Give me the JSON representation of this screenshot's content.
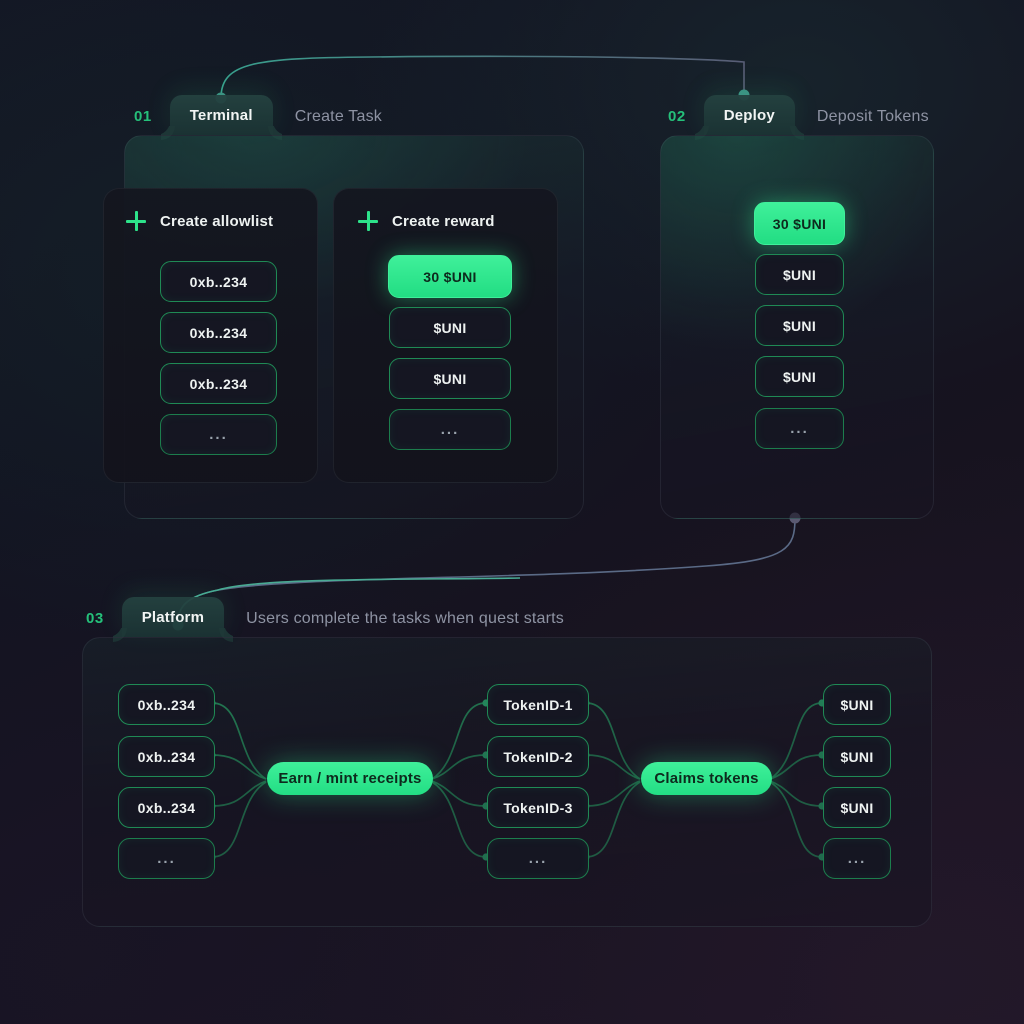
{
  "theme": {
    "accent": "#2EE48A",
    "accent_dark": "#1F8A55",
    "step_number_color": "#25C07A",
    "background": "#15131F",
    "muted_text": "#8E93A3"
  },
  "steps": [
    {
      "number": "01",
      "tab_label": "Terminal",
      "description": "Create Task",
      "panels": [
        {
          "icon": "plus-icon",
          "title": "Create allowlist",
          "items": [
            {
              "label": "0xb..234",
              "highlighted": false
            },
            {
              "label": "0xb..234",
              "highlighted": false
            },
            {
              "label": "0xb..234",
              "highlighted": false
            },
            {
              "label": "...",
              "highlighted": false,
              "is_dots": true
            }
          ]
        },
        {
          "icon": "plus-icon",
          "title": "Create reward",
          "items": [
            {
              "label": "30 $UNI",
              "highlighted": true
            },
            {
              "label": "$UNI",
              "highlighted": false
            },
            {
              "label": "$UNI",
              "highlighted": false
            },
            {
              "label": "...",
              "highlighted": false,
              "is_dots": true
            }
          ]
        }
      ]
    },
    {
      "number": "02",
      "tab_label": "Deploy",
      "description": "Deposit Tokens",
      "items": [
        {
          "label": "30 $UNI",
          "highlighted": true
        },
        {
          "label": "$UNI",
          "highlighted": false
        },
        {
          "label": "$UNI",
          "highlighted": false
        },
        {
          "label": "$UNI",
          "highlighted": false
        },
        {
          "label": "...",
          "highlighted": false,
          "is_dots": true
        }
      ]
    },
    {
      "number": "03",
      "tab_label": "Platform",
      "description": "Users complete the tasks when quest starts",
      "columns": [
        {
          "name": "wallets",
          "items": [
            {
              "label": "0xb..234"
            },
            {
              "label": "0xb..234"
            },
            {
              "label": "0xb..234"
            },
            {
              "label": "...",
              "is_dots": true
            }
          ]
        },
        {
          "name": "token-ids",
          "items": [
            {
              "label": "TokenID-1"
            },
            {
              "label": "TokenID-2"
            },
            {
              "label": "TokenID-3"
            },
            {
              "label": "...",
              "is_dots": true
            }
          ]
        },
        {
          "name": "rewards",
          "items": [
            {
              "label": "$UNI"
            },
            {
              "label": "$UNI"
            },
            {
              "label": "$UNI"
            },
            {
              "label": "...",
              "is_dots": true
            }
          ]
        }
      ],
      "hubs": [
        {
          "name": "earn-mint-receipts",
          "label": "Earn / mint receipts"
        },
        {
          "name": "claims-tokens",
          "label": "Claims tokens"
        }
      ]
    }
  ]
}
